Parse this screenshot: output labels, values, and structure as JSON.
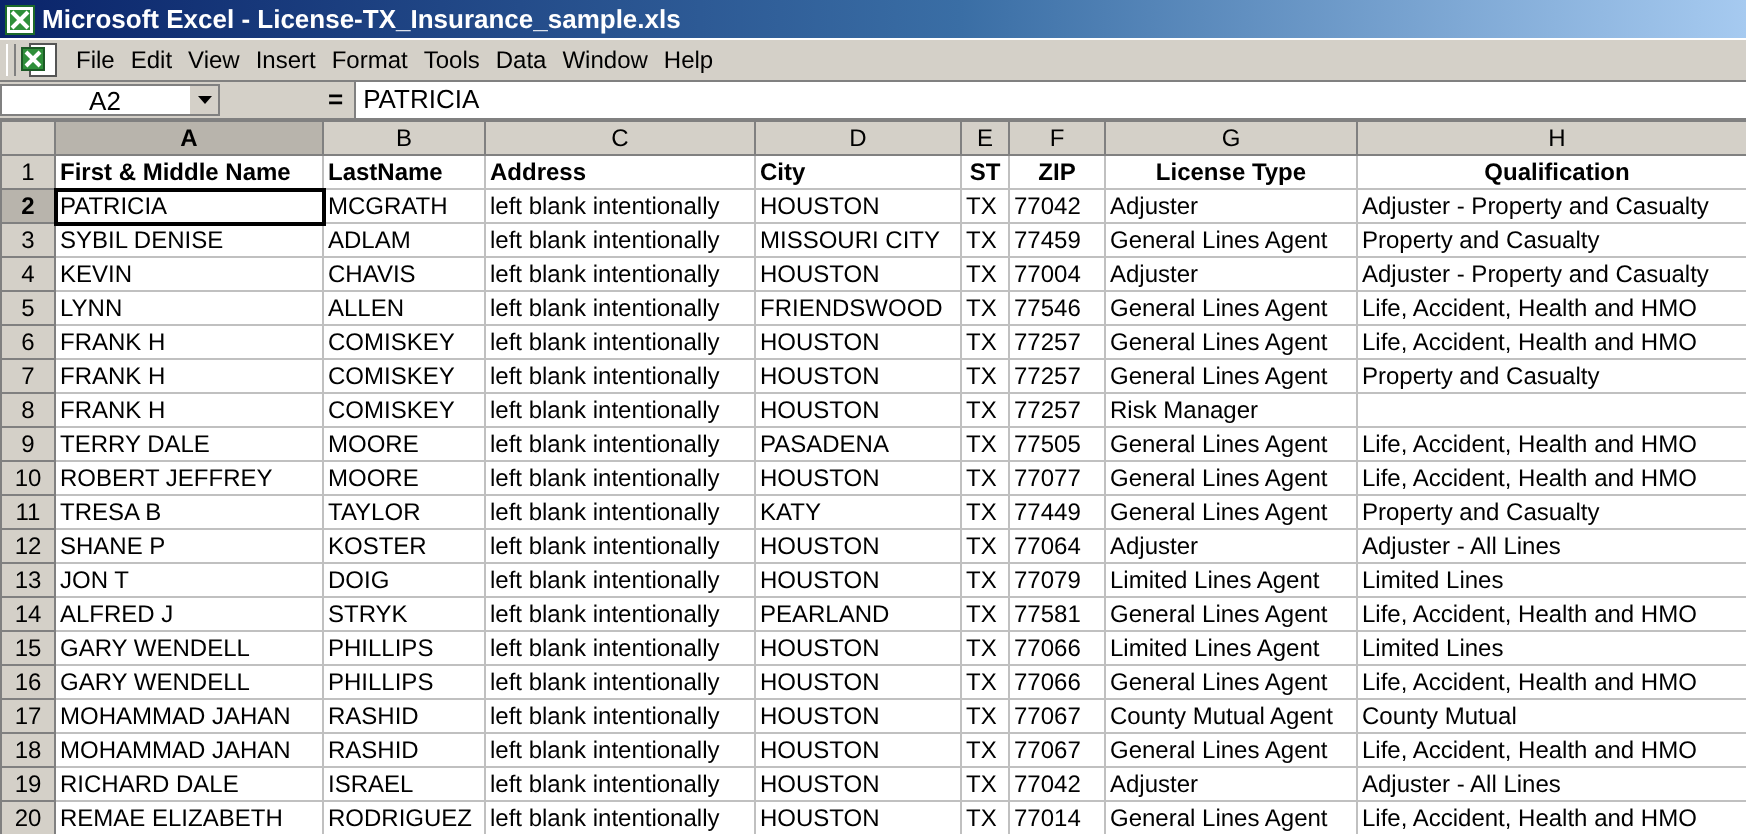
{
  "window": {
    "title": "Microsoft Excel - License-TX_Insurance_sample.xls"
  },
  "menu": [
    "File",
    "Edit",
    "View",
    "Insert",
    "Format",
    "Tools",
    "Data",
    "Window",
    "Help"
  ],
  "formula_bar": {
    "name_box": "A2",
    "equals": "=",
    "value": "PATRICIA"
  },
  "columns": [
    {
      "label": "A",
      "selected": true
    },
    {
      "label": "B",
      "selected": false
    },
    {
      "label": "C",
      "selected": false
    },
    {
      "label": "D",
      "selected": false
    },
    {
      "label": "E",
      "selected": false
    },
    {
      "label": "F",
      "selected": false
    },
    {
      "label": "G",
      "selected": false
    },
    {
      "label": "H",
      "selected": false
    }
  ],
  "rows": [
    {
      "number": "1",
      "selected": false,
      "header": true,
      "cells": [
        "First & Middle Name",
        "LastName",
        "Address",
        "City",
        "ST",
        "ZIP",
        "License Type",
        "Qualification"
      ]
    },
    {
      "number": "2",
      "selected": true,
      "header": false,
      "cells": [
        "PATRICIA",
        "MCGRATH",
        "left blank intentionally",
        "HOUSTON",
        "TX",
        "77042",
        "Adjuster",
        "Adjuster - Property and Casualty"
      ]
    },
    {
      "number": "3",
      "selected": false,
      "header": false,
      "cells": [
        "SYBIL DENISE",
        "ADLAM",
        "left blank intentionally",
        "MISSOURI CITY",
        "TX",
        "77459",
        "General Lines Agent",
        "Property and Casualty"
      ]
    },
    {
      "number": "4",
      "selected": false,
      "header": false,
      "cells": [
        "KEVIN",
        "CHAVIS",
        "left blank intentionally",
        "HOUSTON",
        "TX",
        "77004",
        "Adjuster",
        "Adjuster - Property and Casualty"
      ]
    },
    {
      "number": "5",
      "selected": false,
      "header": false,
      "cells": [
        "LYNN",
        "ALLEN",
        "left blank intentionally",
        "FRIENDSWOOD",
        "TX",
        "77546",
        "General Lines Agent",
        "Life, Accident, Health and HMO"
      ]
    },
    {
      "number": "6",
      "selected": false,
      "header": false,
      "cells": [
        "FRANK H",
        "COMISKEY",
        "left blank intentionally",
        "HOUSTON",
        "TX",
        "77257",
        "General Lines Agent",
        "Life, Accident, Health and HMO"
      ]
    },
    {
      "number": "7",
      "selected": false,
      "header": false,
      "cells": [
        "FRANK H",
        "COMISKEY",
        "left blank intentionally",
        "HOUSTON",
        "TX",
        "77257",
        "General Lines Agent",
        "Property and Casualty"
      ]
    },
    {
      "number": "8",
      "selected": false,
      "header": false,
      "cells": [
        "FRANK H",
        "COMISKEY",
        "left blank intentionally",
        "HOUSTON",
        "TX",
        "77257",
        "Risk Manager",
        ""
      ]
    },
    {
      "number": "9",
      "selected": false,
      "header": false,
      "cells": [
        "TERRY DALE",
        "MOORE",
        "left blank intentionally",
        "PASADENA",
        "TX",
        "77505",
        "General Lines Agent",
        "Life, Accident, Health and HMO"
      ]
    },
    {
      "number": "10",
      "selected": false,
      "header": false,
      "cells": [
        "ROBERT JEFFREY",
        "MOORE",
        "left blank intentionally",
        "HOUSTON",
        "TX",
        "77077",
        "General Lines Agent",
        "Life, Accident, Health and HMO"
      ]
    },
    {
      "number": "11",
      "selected": false,
      "header": false,
      "cells": [
        "TRESA B",
        "TAYLOR",
        "left blank intentionally",
        "KATY",
        "TX",
        "77449",
        "General Lines Agent",
        "Property and Casualty"
      ]
    },
    {
      "number": "12",
      "selected": false,
      "header": false,
      "cells": [
        "SHANE P",
        "KOSTER",
        "left blank intentionally",
        "HOUSTON",
        "TX",
        "77064",
        "Adjuster",
        "Adjuster - All Lines"
      ]
    },
    {
      "number": "13",
      "selected": false,
      "header": false,
      "cells": [
        "JON T",
        "DOIG",
        "left blank intentionally",
        "HOUSTON",
        "TX",
        "77079",
        "Limited Lines Agent",
        "Limited Lines"
      ]
    },
    {
      "number": "14",
      "selected": false,
      "header": false,
      "cells": [
        "ALFRED J",
        "STRYK",
        "left blank intentionally",
        "PEARLAND",
        "TX",
        "77581",
        "General Lines Agent",
        "Life, Accident, Health and HMO"
      ]
    },
    {
      "number": "15",
      "selected": false,
      "header": false,
      "cells": [
        "GARY WENDELL",
        "PHILLIPS",
        "left blank intentionally",
        "HOUSTON",
        "TX",
        "77066",
        "Limited Lines Agent",
        "Limited Lines"
      ]
    },
    {
      "number": "16",
      "selected": false,
      "header": false,
      "cells": [
        "GARY WENDELL",
        "PHILLIPS",
        "left blank intentionally",
        "HOUSTON",
        "TX",
        "77066",
        "General Lines Agent",
        "Life, Accident, Health and HMO"
      ]
    },
    {
      "number": "17",
      "selected": false,
      "header": false,
      "cells": [
        "MOHAMMAD JAHAN",
        "RASHID",
        "left blank intentionally",
        "HOUSTON",
        "TX",
        "77067",
        "County Mutual Agent",
        "County Mutual"
      ]
    },
    {
      "number": "18",
      "selected": false,
      "header": false,
      "cells": [
        "MOHAMMAD JAHAN",
        "RASHID",
        "left blank intentionally",
        "HOUSTON",
        "TX",
        "77067",
        "General Lines Agent",
        "Life, Accident, Health and HMO"
      ]
    },
    {
      "number": "19",
      "selected": false,
      "header": false,
      "cells": [
        "RICHARD DALE",
        "ISRAEL",
        "left blank intentionally",
        "HOUSTON",
        "TX",
        "77042",
        "Adjuster",
        "Adjuster - All Lines"
      ]
    },
    {
      "number": "20",
      "selected": false,
      "header": false,
      "cells": [
        "REMAE ELIZABETH",
        "RODRIGUEZ",
        "left blank intentionally",
        "HOUSTON",
        "TX",
        "77014",
        "General Lines Agent",
        "Life, Accident, Health and HMO"
      ]
    }
  ]
}
